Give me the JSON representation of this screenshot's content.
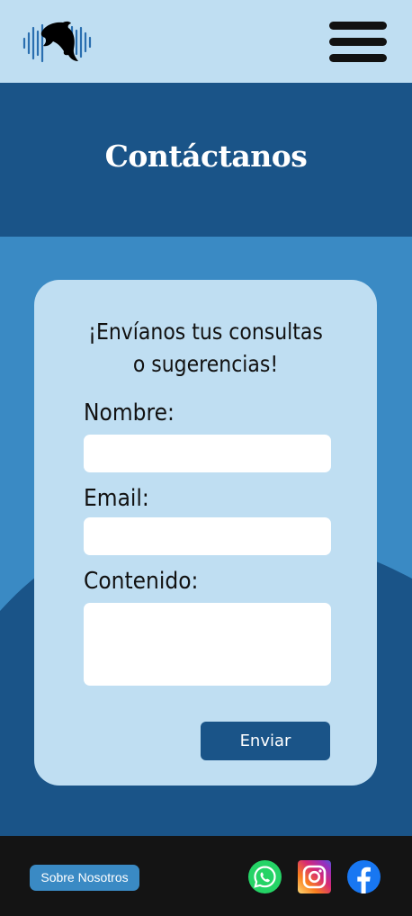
{
  "header": {
    "logo_icon": "dolphin-soundwave-logo",
    "menu_icon": "hamburger-menu-icon"
  },
  "hero": {
    "title": "Contáctanos"
  },
  "form": {
    "subtitle": "¡Envíanos tus consultas o sugerencias!",
    "name_label": "Nombre:",
    "name_value": "",
    "email_label": "Email:",
    "email_value": "",
    "content_label": "Contenido:",
    "content_value": "",
    "submit_label": "Enviar"
  },
  "footer": {
    "about_label": "Sobre Nosotros",
    "social": [
      "whatsapp-icon",
      "instagram-icon",
      "facebook-icon"
    ]
  },
  "colors": {
    "primary_dark": "#1a5488",
    "primary": "#3a8ac4",
    "light": "#bfdef2",
    "footer": "#141414"
  }
}
